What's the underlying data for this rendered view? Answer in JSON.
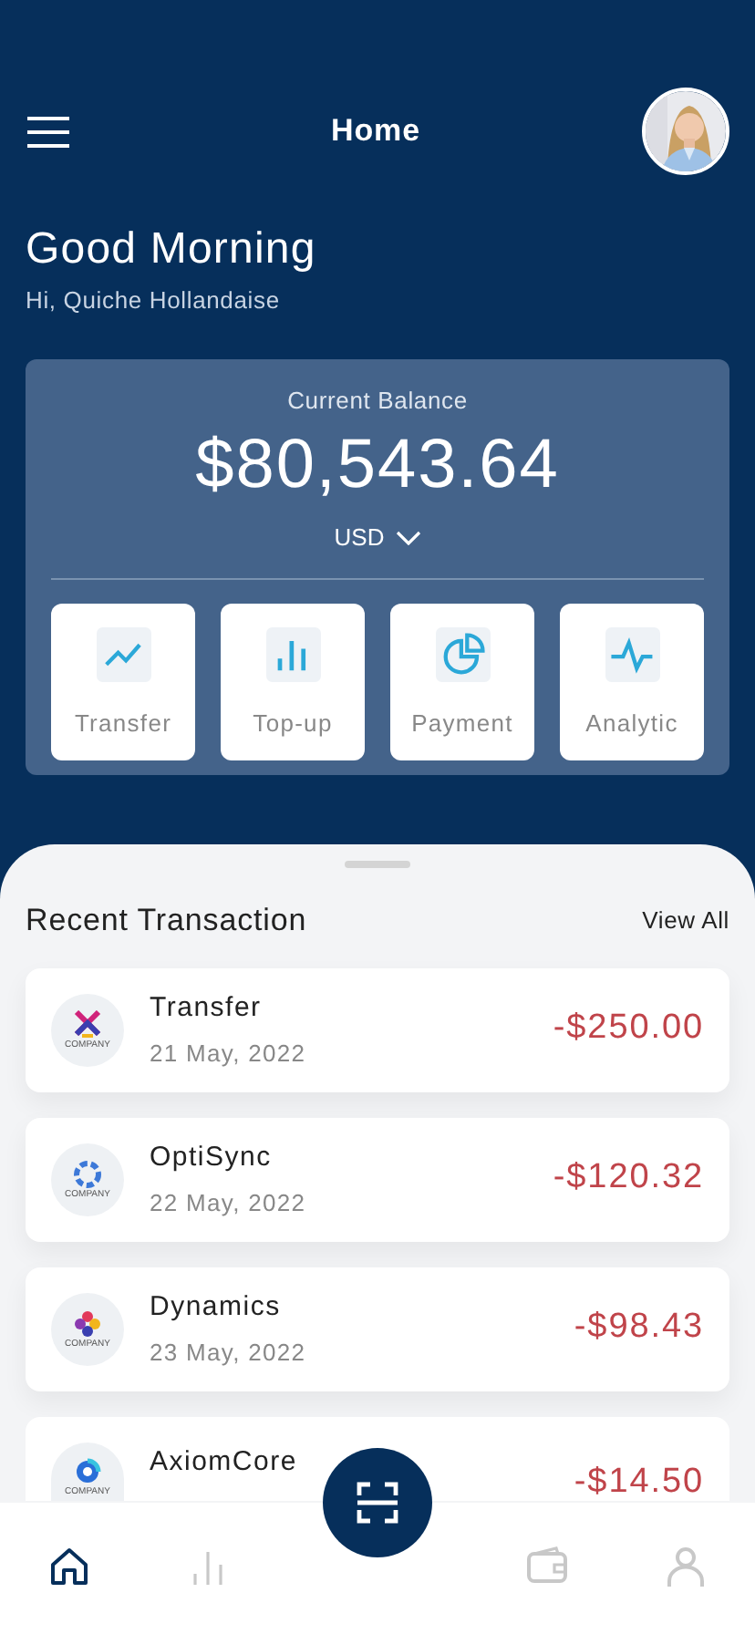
{
  "header": {
    "title": "Home"
  },
  "greeting": {
    "title": "Good Morning",
    "subtitle": "Hi, Quiche Hollandaise"
  },
  "balance": {
    "label": "Current Balance",
    "amount": "$80,543.64",
    "currency": "USD"
  },
  "actions": [
    {
      "kind": "trend",
      "label": "Transfer"
    },
    {
      "kind": "bars",
      "label": "Top-up"
    },
    {
      "kind": "pie",
      "label": "Payment"
    },
    {
      "kind": "pulse",
      "label": "Analytic"
    }
  ],
  "transactions_section": {
    "title": "Recent Transaction",
    "link": "View All"
  },
  "transactions": [
    {
      "kind": "cross",
      "logo_text": "COMPANY",
      "name": "Transfer",
      "date": "21 May, 2022",
      "amount": "-$250.00"
    },
    {
      "kind": "ring",
      "logo_text": "COMPANY",
      "name": "OptiSync",
      "date": "22 May, 2022",
      "amount": "-$120.32"
    },
    {
      "kind": "flower",
      "logo_text": "COMPANY",
      "name": "Dynamics",
      "date": "23 May, 2022",
      "amount": "-$98.43"
    },
    {
      "kind": "swirl",
      "logo_text": "COMPANY",
      "name": "AxiomCore",
      "amount": "-$14.50"
    }
  ],
  "nav": [
    {
      "kind": "home",
      "selected": true
    },
    {
      "kind": "stats",
      "selected": false
    },
    {
      "kind": "scan",
      "selected": false
    },
    {
      "kind": "wallet",
      "selected": false
    },
    {
      "kind": "profile",
      "selected": false
    }
  ]
}
